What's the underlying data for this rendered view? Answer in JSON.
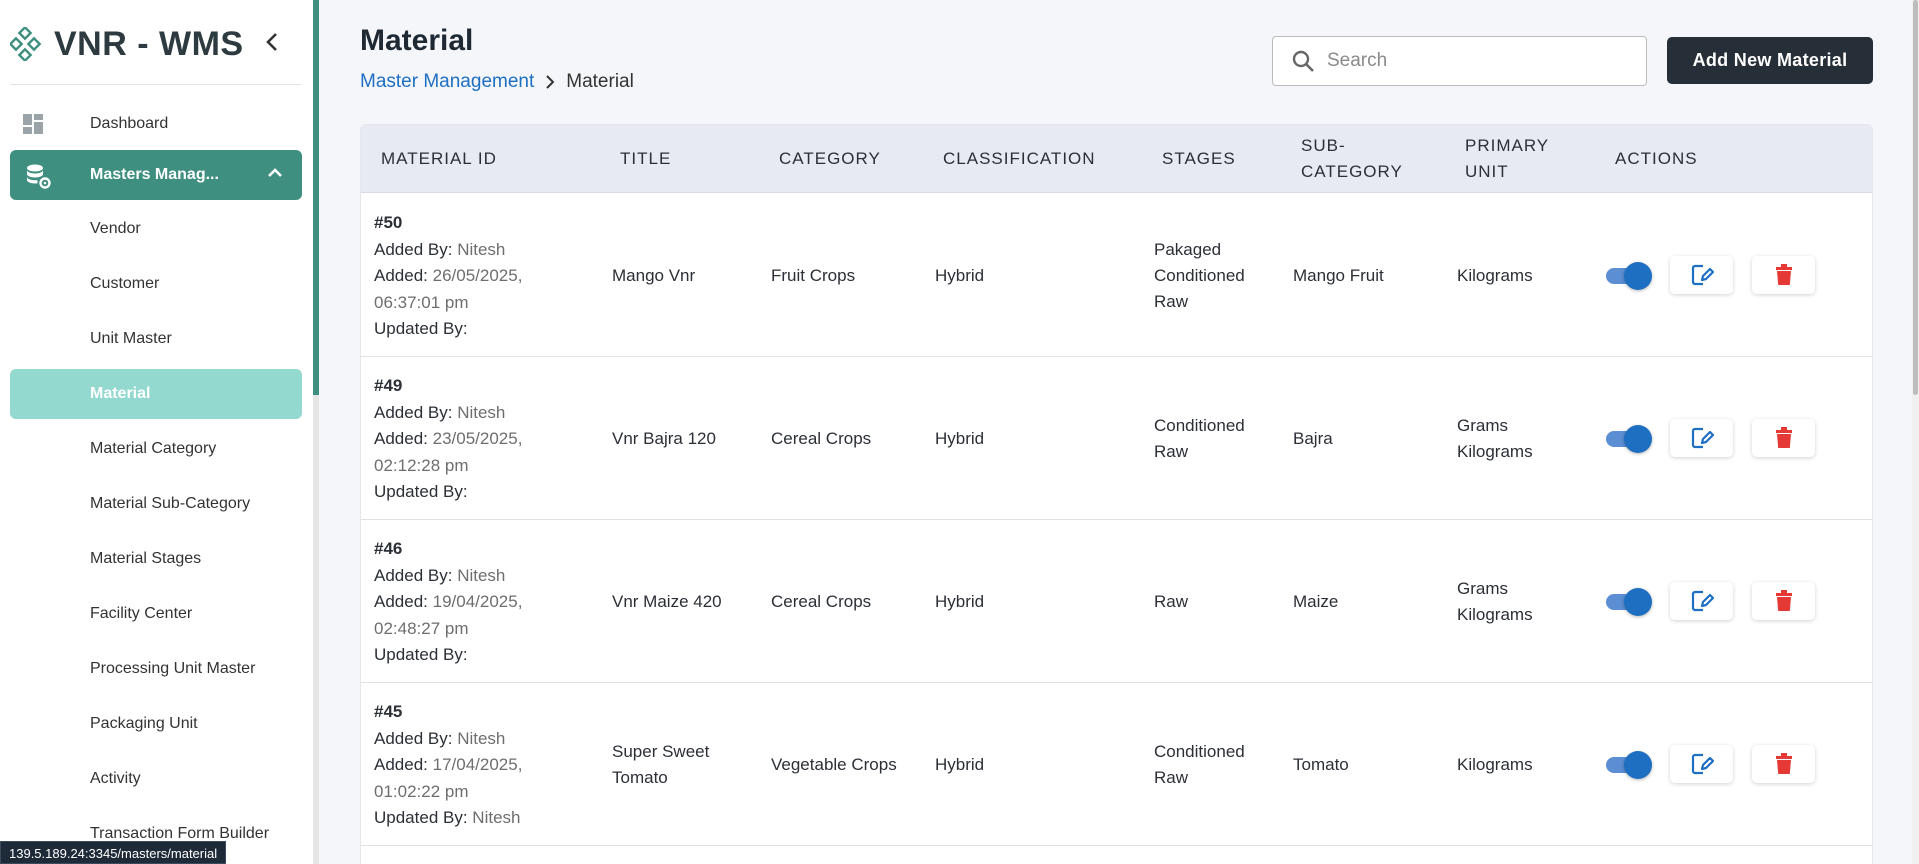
{
  "sidebar": {
    "brand": "VNR - WMS",
    "dashboard_label": "Dashboard",
    "masters_label": "Masters Manag...",
    "sub_items": [
      {
        "label": "Vendor"
      },
      {
        "label": "Customer"
      },
      {
        "label": "Unit Master"
      },
      {
        "label": "Material",
        "active": true
      },
      {
        "label": "Material Category"
      },
      {
        "label": "Material Sub-Category"
      },
      {
        "label": "Material Stages"
      },
      {
        "label": "Facility Center"
      },
      {
        "label": "Processing Unit Master"
      },
      {
        "label": "Packaging Unit"
      },
      {
        "label": "Activity"
      },
      {
        "label": "Transaction Form Builder"
      }
    ]
  },
  "status_url": "139.5.189.24:3345/masters/material",
  "header": {
    "title": "Material",
    "breadcrumb_parent": "Master Management",
    "breadcrumb_current": "Material",
    "search_placeholder": "Search",
    "add_button": "Add New Material"
  },
  "table": {
    "columns": [
      {
        "label": "MATERIAL ID"
      },
      {
        "label": "TITLE"
      },
      {
        "label": "CATEGORY"
      },
      {
        "label": "CLASSIFICATION"
      },
      {
        "label": "STAGES"
      },
      {
        "label": "SUB-\nCATEGORY"
      },
      {
        "label": "PRIMARY\nUNIT"
      },
      {
        "label": "ACTIONS"
      }
    ],
    "labels": {
      "added_by": "Added By:",
      "added": "Added:",
      "updated_by": "Updated By:"
    },
    "rows": [
      {
        "id": "#50",
        "added_by": "Nitesh",
        "added": "26/05/2025,\n06:37:01 pm",
        "updated_by": "",
        "title": "Mango Vnr",
        "category": "Fruit Crops",
        "classification": "Hybrid",
        "stages": "Pakaged\nConditioned\nRaw",
        "sub_category": "Mango Fruit",
        "primary_unit": "Kilograms",
        "active": true
      },
      {
        "id": "#49",
        "added_by": "Nitesh",
        "added": "23/05/2025,\n02:12:28 pm",
        "updated_by": "",
        "title": "Vnr Bajra 120",
        "category": "Cereal Crops",
        "classification": "Hybrid",
        "stages": "Conditioned\nRaw",
        "sub_category": "Bajra",
        "primary_unit": "Grams\nKilograms",
        "active": true
      },
      {
        "id": "#46",
        "added_by": "Nitesh",
        "added": "19/04/2025,\n02:48:27 pm",
        "updated_by": "",
        "title": "Vnr Maize 420",
        "category": "Cereal Crops",
        "classification": "Hybrid",
        "stages": "Raw",
        "sub_category": "Maize",
        "primary_unit": "Grams\nKilograms",
        "active": true
      },
      {
        "id": "#45",
        "added_by": "Nitesh",
        "added": "17/04/2025,\n01:02:22 pm",
        "updated_by": "Nitesh",
        "title": "Super Sweet\nTomato",
        "category": "Vegetable Crops",
        "classification": "Hybrid",
        "stages": "Conditioned\nRaw",
        "sub_category": "Tomato",
        "primary_unit": "Kilograms",
        "active": true
      }
    ]
  },
  "colors": {
    "accent": "#3f8f80",
    "active_sub": "#93d9cf",
    "primary_blue": "#1e6fc2",
    "delete_red": "#e53935",
    "add_button_bg": "#262e38"
  },
  "icons": {
    "brand": "diamond-grid-logo-icon",
    "dashboard": "dashboard-grid-icon",
    "masters": "database-gear-icon",
    "collapse": "chevron-left-icon",
    "expand": "chevron-up-icon",
    "search": "search-icon",
    "edit": "edit-icon",
    "delete": "trash-icon"
  }
}
